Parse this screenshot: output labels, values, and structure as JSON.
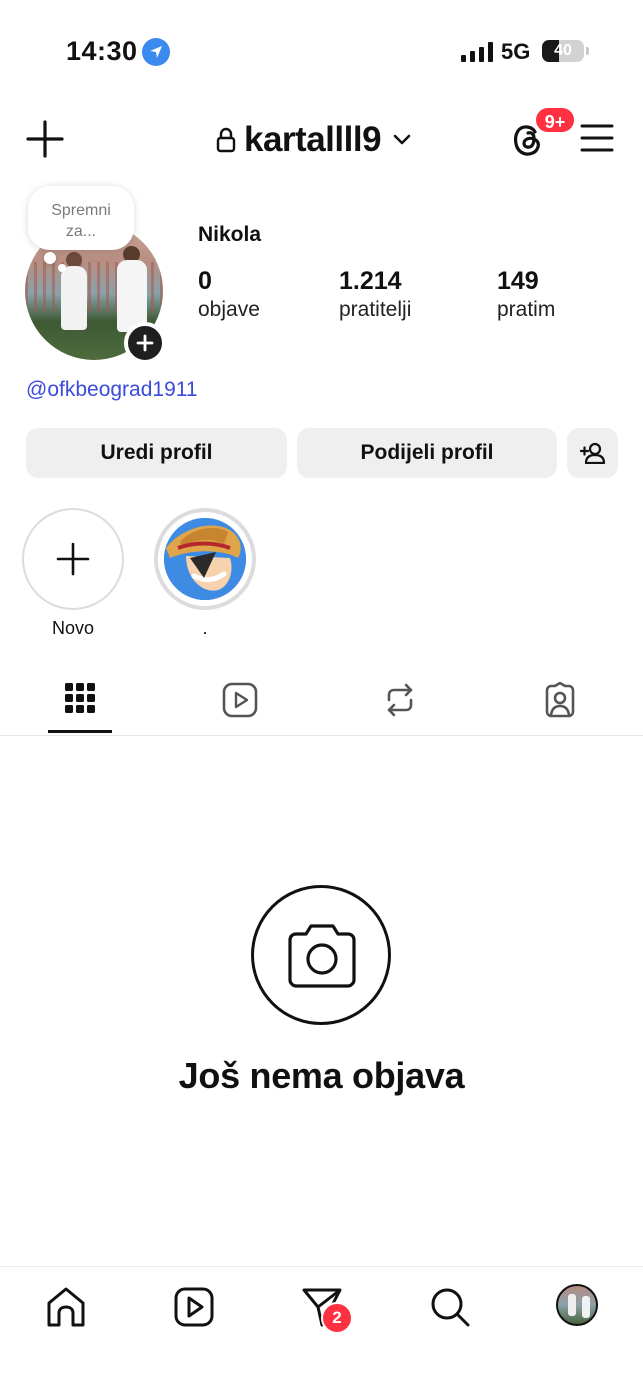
{
  "status_bar": {
    "time": "14:30",
    "network": "5G",
    "battery_level": 40,
    "battery_text": "40"
  },
  "header": {
    "username": "kartallll9",
    "threads_badge": "9+"
  },
  "profile": {
    "note": "Spremni za...",
    "display_name": "Nikola",
    "stats": [
      {
        "value": "0",
        "label": "objave"
      },
      {
        "value": "1.214",
        "label": "pratitelji"
      },
      {
        "value": "149",
        "label": "pratim"
      }
    ],
    "link": "@ofkbeograd1911"
  },
  "buttons": {
    "edit": "Uredi profil",
    "share": "Podijeli profil"
  },
  "highlights": [
    {
      "label": "Novo"
    },
    {
      "label": "."
    }
  ],
  "empty_state": {
    "title": "Još nema objava"
  },
  "bottom_nav": {
    "messages_badge": "2"
  },
  "icons": {
    "header": [
      "plus-icon",
      "lock-icon",
      "chevron-down-icon",
      "threads-icon",
      "menu-icon"
    ],
    "tabs": [
      "grid-icon",
      "reels-icon",
      "reposts-icon",
      "tagged-icon"
    ],
    "nav": [
      "home-icon",
      "reels-icon",
      "send-icon",
      "search-icon",
      "profile-avatar"
    ]
  },
  "colors": {
    "badge_red": "#ff3040",
    "link_blue": "#3b4bdc",
    "button_gray": "#efefef",
    "location_blue": "#3b8af0"
  }
}
